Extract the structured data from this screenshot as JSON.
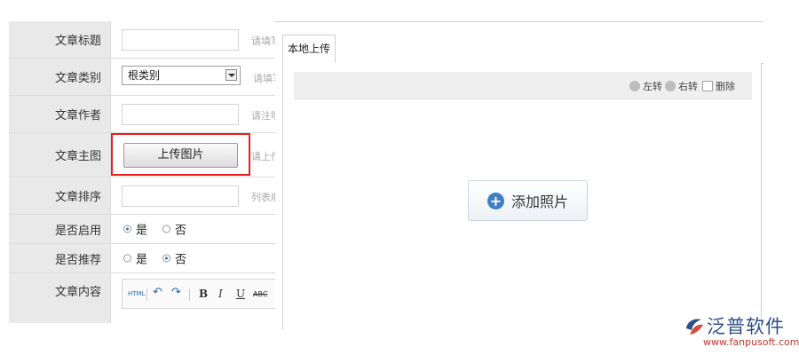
{
  "form": {
    "rows": [
      {
        "label": "文章标题",
        "hint": "请填写"
      },
      {
        "label": "文章类别",
        "select_value": "根类别",
        "hint": "请填写"
      },
      {
        "label": "文章作者",
        "hint": "请注明"
      },
      {
        "label": "文章主图",
        "button": "上传图片",
        "hint": "请上传"
      },
      {
        "label": "文章排序",
        "hint": "列表顺"
      },
      {
        "label": "是否启用",
        "options": [
          "是",
          "否"
        ],
        "selected": "是"
      },
      {
        "label": "是否推荐",
        "options": [
          "是",
          "否"
        ],
        "selected": "否"
      },
      {
        "label": "文章内容"
      }
    ],
    "editor_toolbar": [
      "HTML",
      "↶",
      "↷",
      "B",
      "I",
      "U",
      "ABC"
    ]
  },
  "dialog": {
    "tab": "本地上传",
    "tools": {
      "rotate_left": "左转",
      "rotate_right": "右转",
      "delete": "删除"
    },
    "add_button": "添加照片"
  },
  "watermark": {
    "name": "泛普软件",
    "url": "www.fanpusoft.com"
  },
  "colors": {
    "highlight": "#e61e1e",
    "accent": "#3f7fc4",
    "brand": "#2d4e86"
  }
}
